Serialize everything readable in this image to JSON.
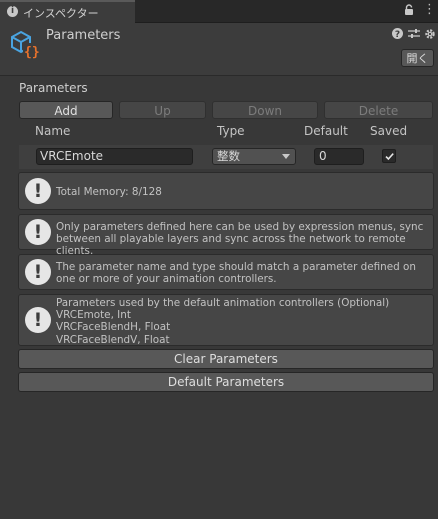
{
  "window": {
    "tab_label": "インスペクター",
    "lock_icon": "lock-icon",
    "menu_icon": "kebab-menu-icon"
  },
  "header": {
    "icon": "vrc-expression-parameters-icon",
    "title": "Parameters",
    "tools": [
      "help-icon",
      "preset-icon",
      "gear-icon"
    ],
    "open_button": "開く"
  },
  "parameters": {
    "section_title": "Parameters",
    "buttons": {
      "add": "Add",
      "up": "Up",
      "down": "Down",
      "delete": "Delete"
    },
    "columns": {
      "name": "Name",
      "type": "Type",
      "default": "Default",
      "saved": "Saved"
    },
    "rows": [
      {
        "name": "VRCEmote",
        "type": "整数",
        "default": "0",
        "saved": true
      }
    ]
  },
  "help_boxes": [
    {
      "text": "Total Memory: 8/128"
    },
    {
      "text": "Only parameters defined here can be used by expression menus, sync between all playable layers and sync across the network to remote clients."
    },
    {
      "text": "The parameter name and type should match a parameter defined on one or more of your animation controllers."
    },
    {
      "lines": [
        "Parameters used by the default animation controllers (Optional)",
        "VRCEmote, Int",
        "VRCFaceBlendH, Float",
        "VRCFaceBlendV, Float"
      ]
    }
  ],
  "actions": {
    "clear": "Clear Parameters",
    "default": "Default Parameters"
  }
}
